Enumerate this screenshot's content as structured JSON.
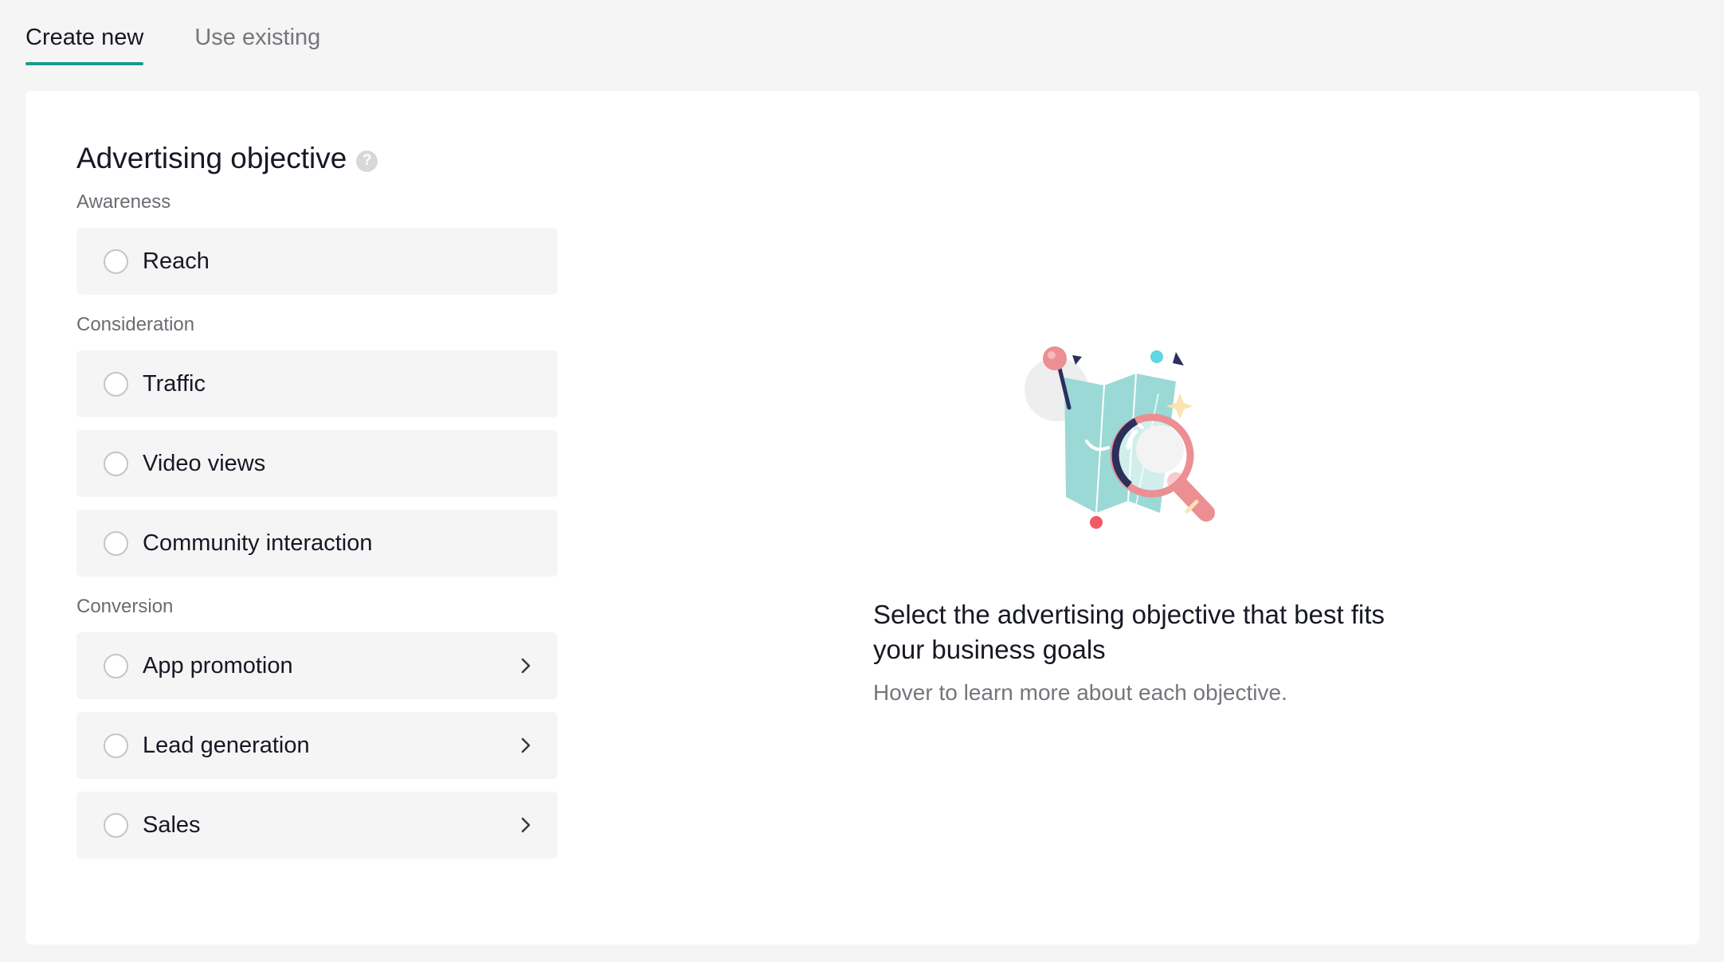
{
  "tabs": [
    {
      "label": "Create new",
      "active": true
    },
    {
      "label": "Use existing",
      "active": false
    }
  ],
  "objective": {
    "title": "Advertising objective",
    "help_icon": "question-circle-icon",
    "groups": [
      {
        "label": "Awareness",
        "options": [
          {
            "label": "Reach",
            "has_chevron": false
          }
        ]
      },
      {
        "label": "Consideration",
        "options": [
          {
            "label": "Traffic",
            "has_chevron": false
          },
          {
            "label": "Video views",
            "has_chevron": false
          },
          {
            "label": "Community interaction",
            "has_chevron": false
          }
        ]
      },
      {
        "label": "Conversion",
        "options": [
          {
            "label": "App promotion",
            "has_chevron": true
          },
          {
            "label": "Lead generation",
            "has_chevron": true
          },
          {
            "label": "Sales",
            "has_chevron": true
          }
        ]
      }
    ]
  },
  "info_panel": {
    "headline": "Select the advertising objective that best fits your business goals",
    "subtext": "Hover to learn more about each objective.",
    "illustration": "map-magnifier-illustration"
  },
  "colors": {
    "accent": "#1a9a8f",
    "page_bg": "#f5f5f5",
    "option_bg": "#f5f5f6",
    "map": "#9ad9d6",
    "magnifier_ring": "#eb8f92",
    "dark_navy": "#2b2f5a"
  }
}
